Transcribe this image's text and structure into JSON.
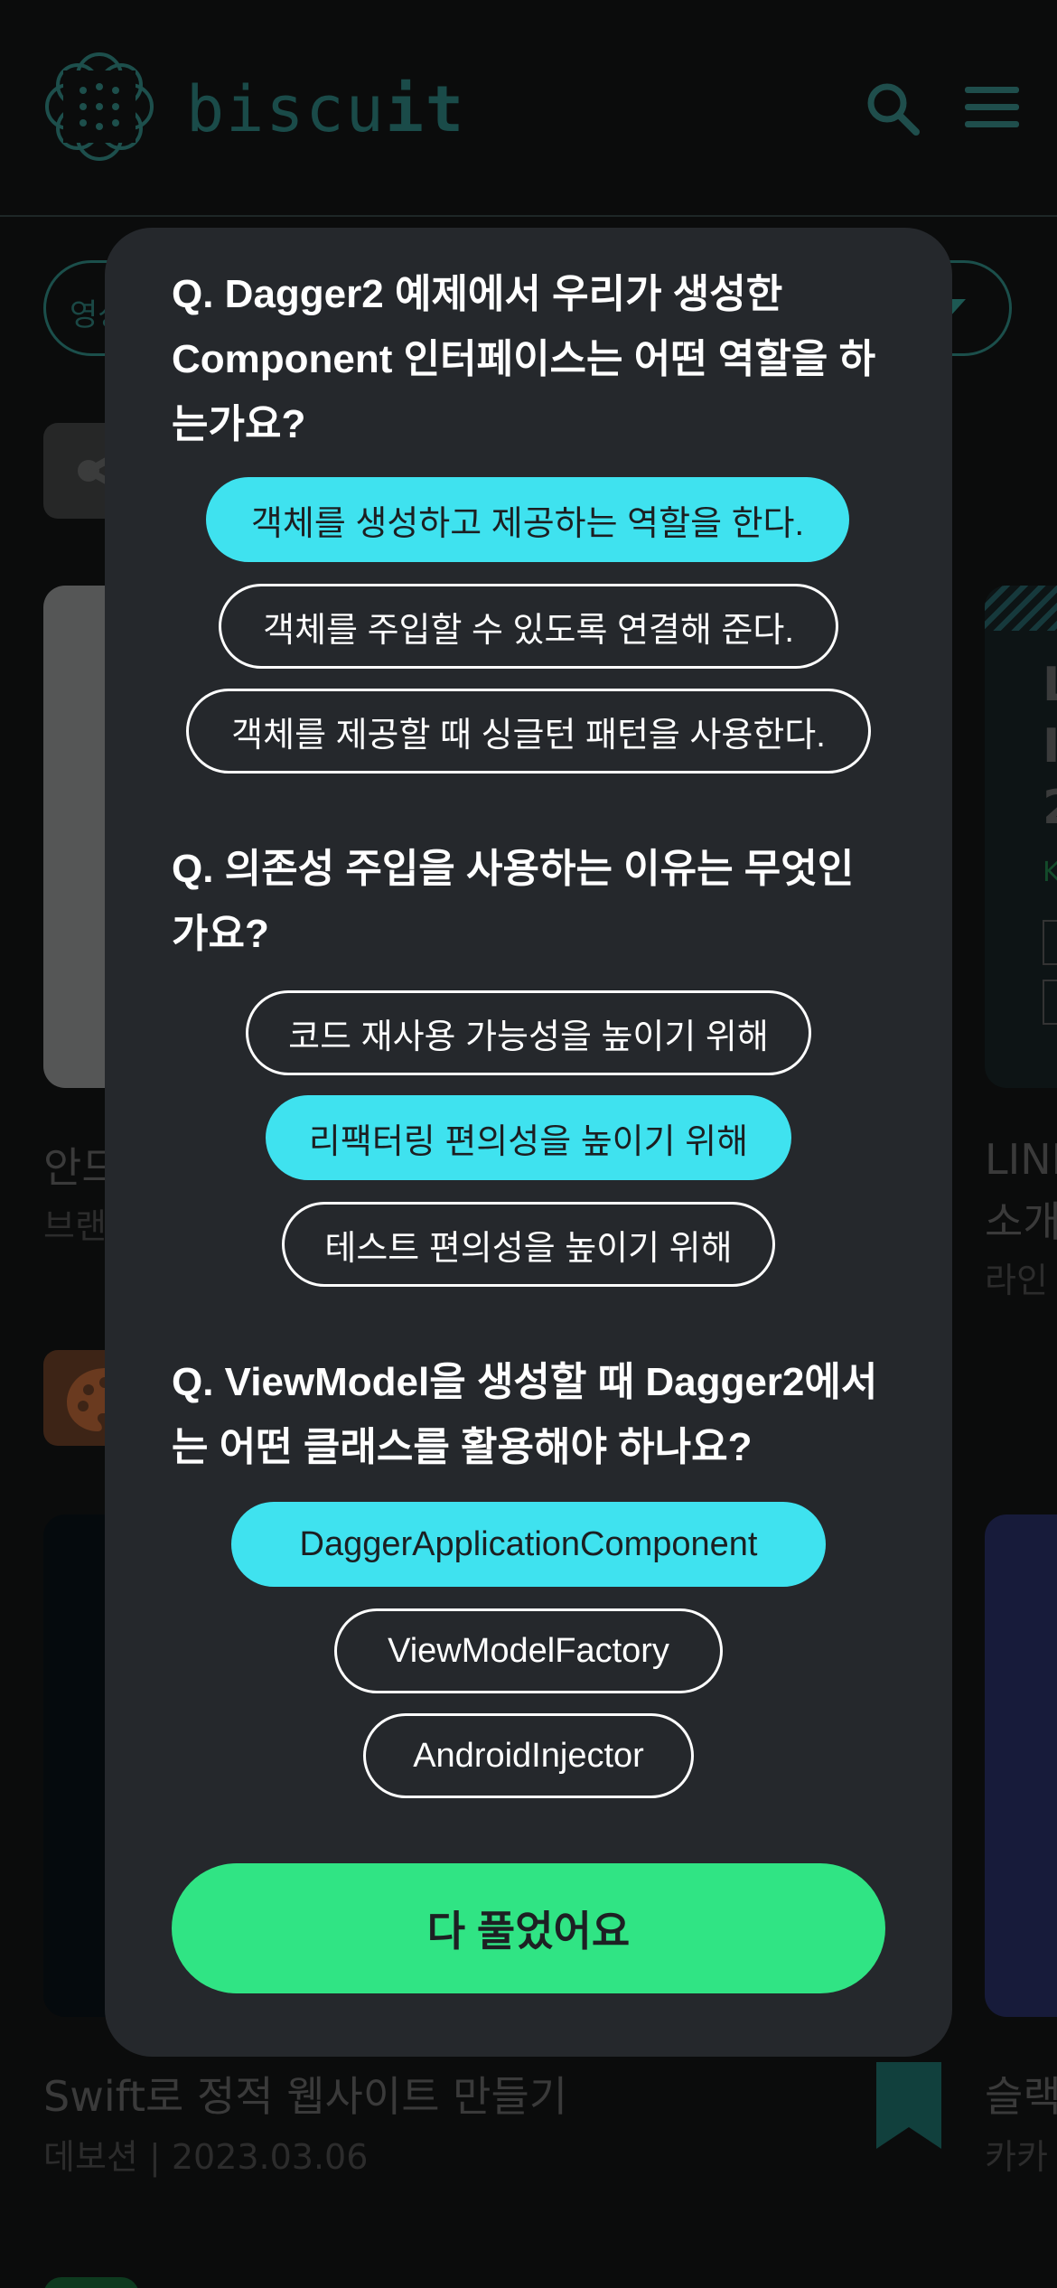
{
  "app": {
    "logo_text_light": "biscu",
    "logo_text_bold": "it",
    "icons": {
      "logo": "cookie-logo-icon",
      "search": "search-icon",
      "menu": "menu-icon",
      "share": "share-icon",
      "palette": "palette-icon",
      "bookmark": "bookmark-icon"
    }
  },
  "background": {
    "filter_text": "영상",
    "cards_row1": {
      "left_title": "안드",
      "left_sub": "브랜",
      "right_title_1": "LINI",
      "right_title_2": "소개",
      "right_sub": "라인"
    },
    "cards_row2": {
      "left_title": "Swift로 정적 웹사이트 만들기",
      "left_sub": "데보션 | 2023.03.06",
      "right_title": "슬랙",
      "right_sub": "카카"
    }
  },
  "quiz": {
    "questions": [
      {
        "text": "Q. Dagger2 예제에서 우리가 생성한 Component 인터페이스는 어떤 역할을 하는가요?",
        "options": [
          {
            "label": "객체를 생성하고 제공하는 역할을 한다.",
            "selected": true
          },
          {
            "label": "객체를 주입할 수 있도록 연결해 준다.",
            "selected": false
          },
          {
            "label": "객체를 제공할 때 싱글턴 패턴을 사용한다.",
            "selected": false
          }
        ]
      },
      {
        "text": "Q. 의존성 주입을 사용하는 이유는 무엇인가요?",
        "options": [
          {
            "label": "코드 재사용 가능성을 높이기 위해",
            "selected": false
          },
          {
            "label": "리팩터링 편의성을 높이기 위해",
            "selected": true
          },
          {
            "label": "테스트 편의성을 높이기 위해",
            "selected": false
          }
        ]
      },
      {
        "text": "Q. ViewModel을 생성할 때 Dagger2에서는 어떤 클래스를 활용해야 하나요?",
        "options": [
          {
            "label": "DaggerApplicationComponent",
            "selected": true
          },
          {
            "label": "ViewModelFactory",
            "selected": false
          },
          {
            "label": "AndroidInjector",
            "selected": false
          }
        ]
      }
    ],
    "submit_label": "다 풀었어요"
  },
  "colors": {
    "modal_bg": "#25282c",
    "selected_option": "#3fe2ef",
    "submit_button": "#30e484",
    "page_bg": "#0b0c0c"
  }
}
